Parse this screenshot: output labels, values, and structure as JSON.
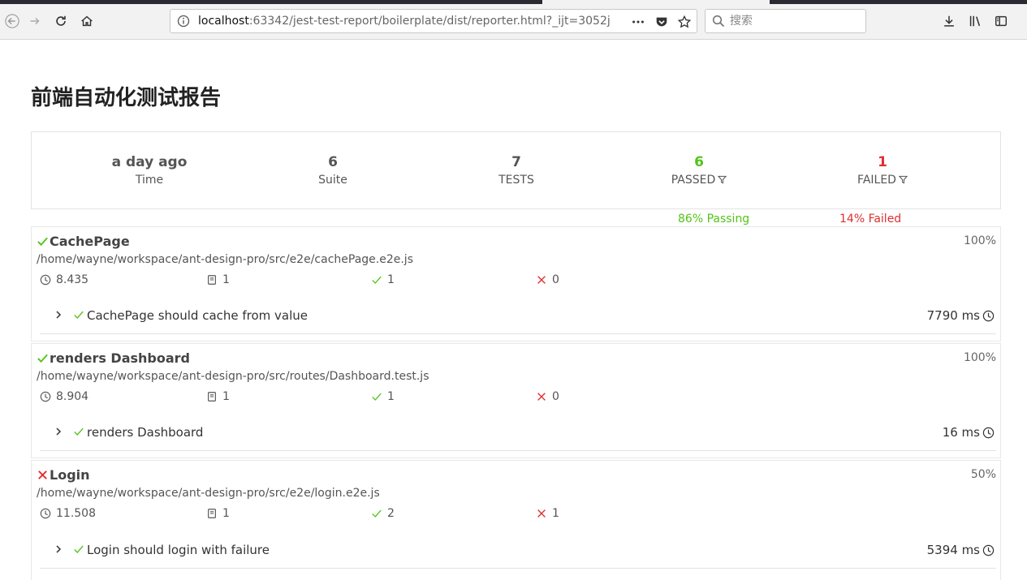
{
  "browser": {
    "url_host": "localhost",
    "url_rest": ":63342/jest-test-report/boilerplate/dist/reporter.html?_ijt=3052j",
    "search_placeholder": "搜索"
  },
  "page": {
    "title": "前端自动化测试报告"
  },
  "summary": {
    "time": {
      "value": "a day ago",
      "label": "Time"
    },
    "suite": {
      "value": "6",
      "label": "Suite"
    },
    "tests": {
      "value": "7",
      "label": "TESTS"
    },
    "passed": {
      "value": "6",
      "label": "PASSED"
    },
    "failed": {
      "value": "1",
      "label": "FAILED"
    },
    "passing_rate": "86% Passing",
    "failed_rate": "14% Failed"
  },
  "colors": {
    "pass": "#52c41a",
    "fail": "#e02f2f"
  },
  "suites": [
    {
      "status": "pass",
      "title": "CachePage",
      "percent": "100%",
      "path": "/home/wayne/workspace/ant-design-pro/src/e2e/cachePage.e2e.js",
      "time": "8.435",
      "tests": "1",
      "passed": "1",
      "failed": "0",
      "case": {
        "status": "pass",
        "title": "CachePage should cache from value",
        "duration": "7790 ms"
      }
    },
    {
      "status": "pass",
      "title": "renders Dashboard",
      "percent": "100%",
      "path": "/home/wayne/workspace/ant-design-pro/src/routes/Dashboard.test.js",
      "time": "8.904",
      "tests": "1",
      "passed": "1",
      "failed": "0",
      "case": {
        "status": "pass",
        "title": "renders Dashboard",
        "duration": "16 ms"
      }
    },
    {
      "status": "fail",
      "title": "Login",
      "percent": "50%",
      "path": "/home/wayne/workspace/ant-design-pro/src/e2e/login.e2e.js",
      "time": "11.508",
      "tests": "1",
      "passed": "2",
      "failed": "1",
      "case": {
        "status": "pass",
        "title": "Login should login with failure",
        "duration": "5394 ms"
      }
    }
  ]
}
